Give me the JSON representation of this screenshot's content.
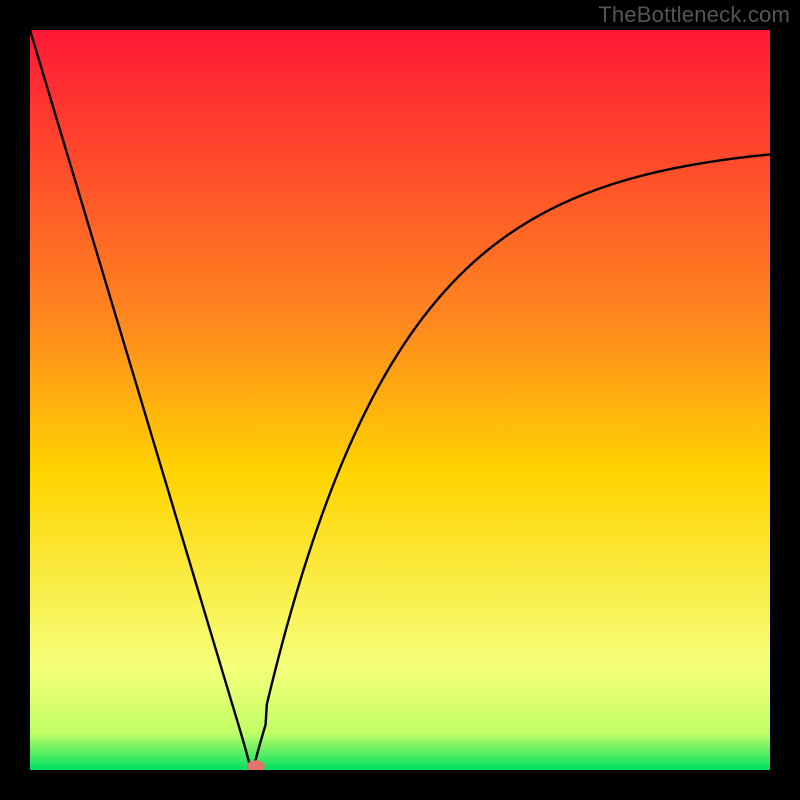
{
  "watermark": "TheBottleneck.com",
  "chart_data": {
    "type": "line",
    "title": "",
    "xlabel": "",
    "ylabel": "",
    "xlim": [
      0,
      100
    ],
    "ylim": [
      0,
      100
    ],
    "x": [
      0,
      5,
      10,
      15,
      20,
      25,
      27,
      29,
      30,
      31,
      33,
      35,
      40,
      45,
      50,
      55,
      60,
      65,
      70,
      75,
      80,
      85,
      90,
      95,
      100
    ],
    "values": [
      100,
      83,
      67,
      50,
      33,
      15,
      7,
      1,
      0,
      1,
      7,
      16,
      33,
      45,
      55,
      62,
      68,
      72,
      75.5,
      78,
      79.5,
      80.8,
      81.8,
      82.5,
      83
    ],
    "minimum_x": 30,
    "minimum_y": 0,
    "background_gradient": {
      "top": "#ff1836",
      "mid": "#ffd400",
      "bottom": "#00e060"
    },
    "marker": {
      "x": 30.5,
      "y": 0.5,
      "color": "#e4736c"
    }
  }
}
